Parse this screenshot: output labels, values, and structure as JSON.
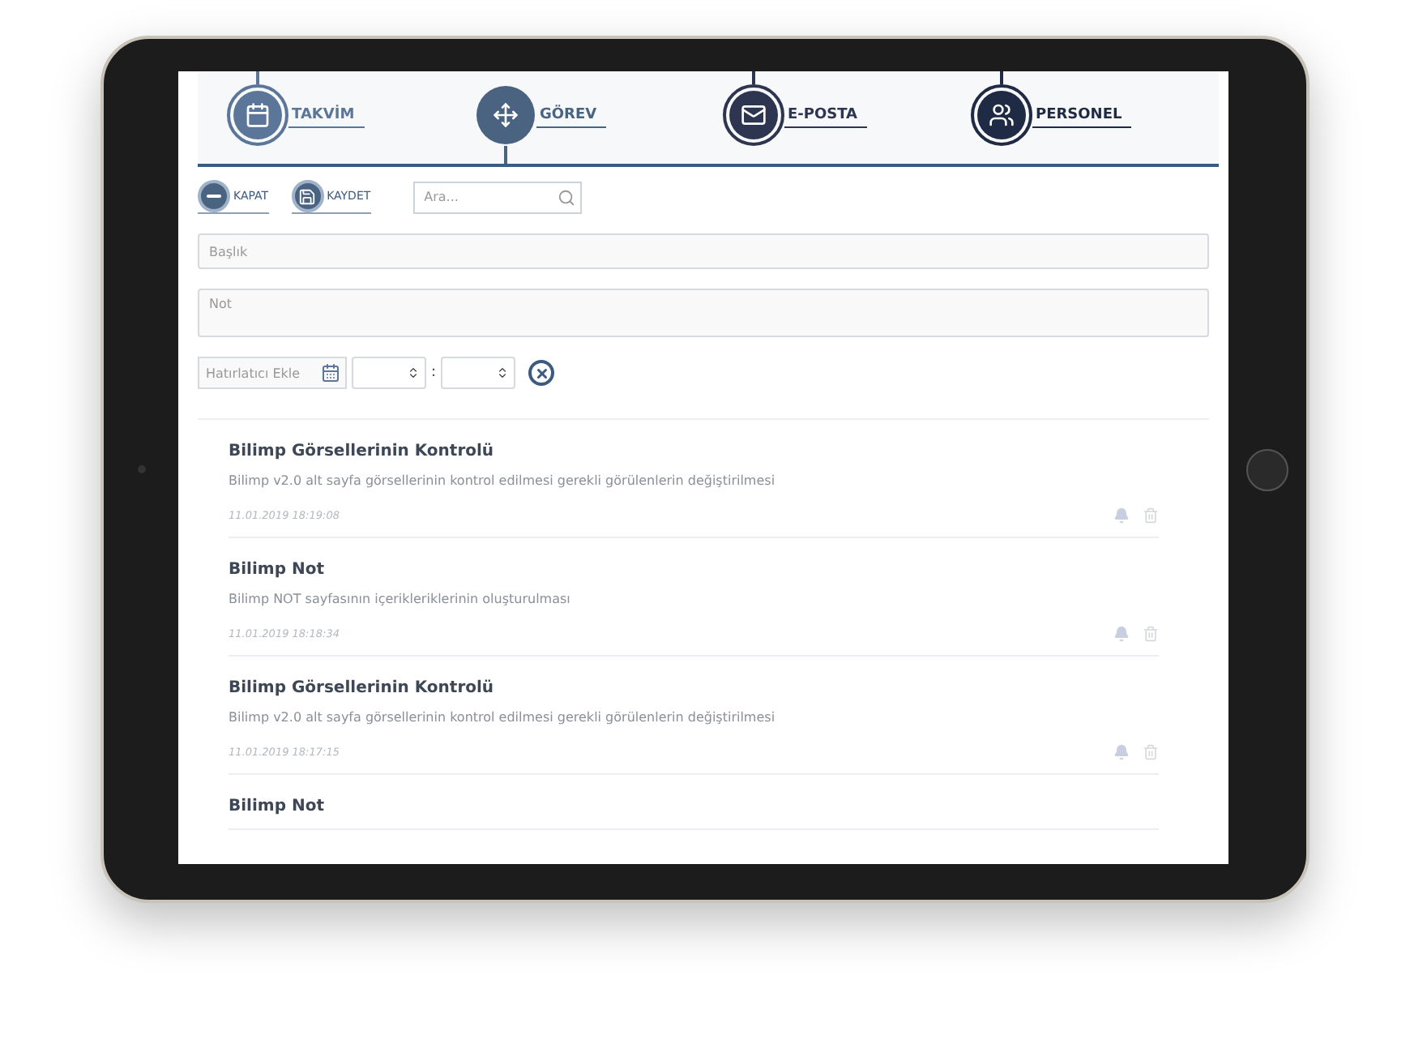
{
  "tabs": [
    {
      "label": "TAKVİM",
      "selected": false,
      "color": "#5b7699"
    },
    {
      "label": "GÖREV",
      "selected": true,
      "color": "#4a6380"
    },
    {
      "label": "E-POSTA",
      "selected": false,
      "color": "#2e3550"
    },
    {
      "label": "PERSONEL",
      "selected": false,
      "color": "#1f2a44"
    }
  ],
  "toolbar": {
    "close_label": "KAPAT",
    "save_label": "KAYDET",
    "search": {
      "placeholder": "Ara..."
    }
  },
  "form": {
    "title": {
      "placeholder": "Başlık"
    },
    "note": {
      "placeholder": "Not"
    },
    "reminder": {
      "placeholder": "Hatırlatıcı Ekle"
    },
    "time_separator": ":"
  },
  "notes": [
    {
      "title": "Bilimp Görsellerinin Kontrolü",
      "description": "Bilimp v2.0 alt sayfa görsellerinin kontrol edilmesi gerekli görülenlerin değiştirilmesi",
      "date": "11.01.2019 18:19:08"
    },
    {
      "title": "Bilimp Not",
      "description": "Bilimp NOT sayfasının içerikleriklerinin oluşturulması",
      "date": "11.01.2019 18:18:34"
    },
    {
      "title": "Bilimp Görsellerinin Kontrolü",
      "description": "Bilimp v2.0 alt sayfa görsellerinin kontrol edilmesi gerekli görülenlerin değiştirilmesi",
      "date": "11.01.2019 18:17:15"
    },
    {
      "title": "Bilimp Not"
    }
  ]
}
